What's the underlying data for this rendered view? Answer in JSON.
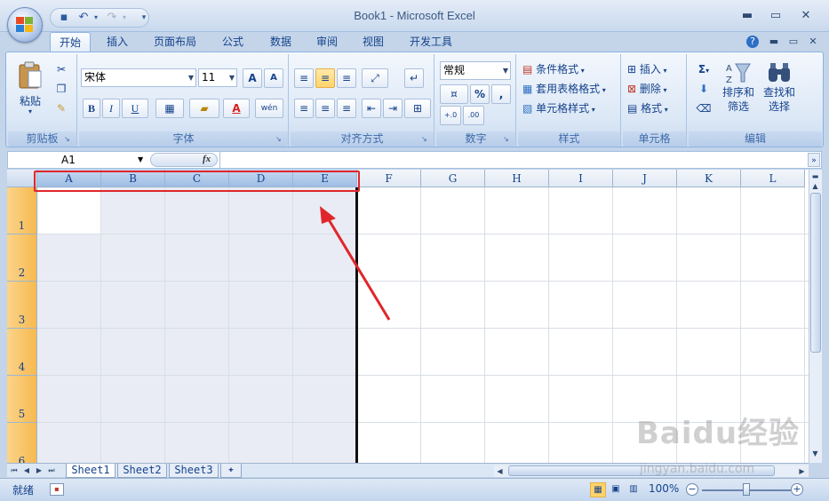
{
  "window": {
    "title": "Book1 - Microsoft Excel",
    "minimize": "▬",
    "maximize": "▭",
    "close": "✕"
  },
  "ribbon_tabs": [
    "开始",
    "插入",
    "页面布局",
    "公式",
    "数据",
    "审阅",
    "视图",
    "开发工具"
  ],
  "clipboard": {
    "paste": "粘贴",
    "label": "剪贴板"
  },
  "font": {
    "name": "宋体",
    "size": "11",
    "label": "字体",
    "bold": "B",
    "italic": "I",
    "underline": "U",
    "grow": "A",
    "shrink": "A",
    "font_color": "A",
    "phonetic": "wén"
  },
  "alignment": {
    "label": "对齐方式"
  },
  "number": {
    "format": "常规",
    "percent": "%",
    "comma": ",",
    "label": "数字",
    "inc_decimal": "+.0",
    "dec_decimal": ".00"
  },
  "styles": {
    "conditional": "条件格式",
    "table": "套用表格格式",
    "cell": "单元格样式",
    "label": "样式"
  },
  "cells": {
    "insert": "插入",
    "delete": "删除",
    "format": "格式",
    "label": "单元格"
  },
  "editing": {
    "sum": "Σ",
    "sort": "排序和",
    "sort2": "筛选",
    "find": "查找和",
    "find2": "选择",
    "label": "编辑"
  },
  "formula_bar": {
    "name_box": "A1",
    "fx": "fx"
  },
  "columns": [
    "A",
    "B",
    "C",
    "D",
    "E",
    "F",
    "G",
    "H",
    "I",
    "J",
    "K",
    "L"
  ],
  "selected_columns": [
    "A",
    "B",
    "C",
    "D",
    "E"
  ],
  "rows": [
    "1",
    "2",
    "3",
    "4",
    "5",
    "6"
  ],
  "sheets": [
    "Sheet1",
    "Sheet2",
    "Sheet3"
  ],
  "active_sheet": "Sheet1",
  "status": {
    "ready": "就绪",
    "zoom": "100%"
  },
  "watermark": {
    "main": "Baidu经验",
    "url": "jingyan.baidu.com"
  },
  "colors": {
    "highlight": "#e0262b",
    "selection": "#e9ecf5",
    "row_header": "#f6b94f"
  }
}
